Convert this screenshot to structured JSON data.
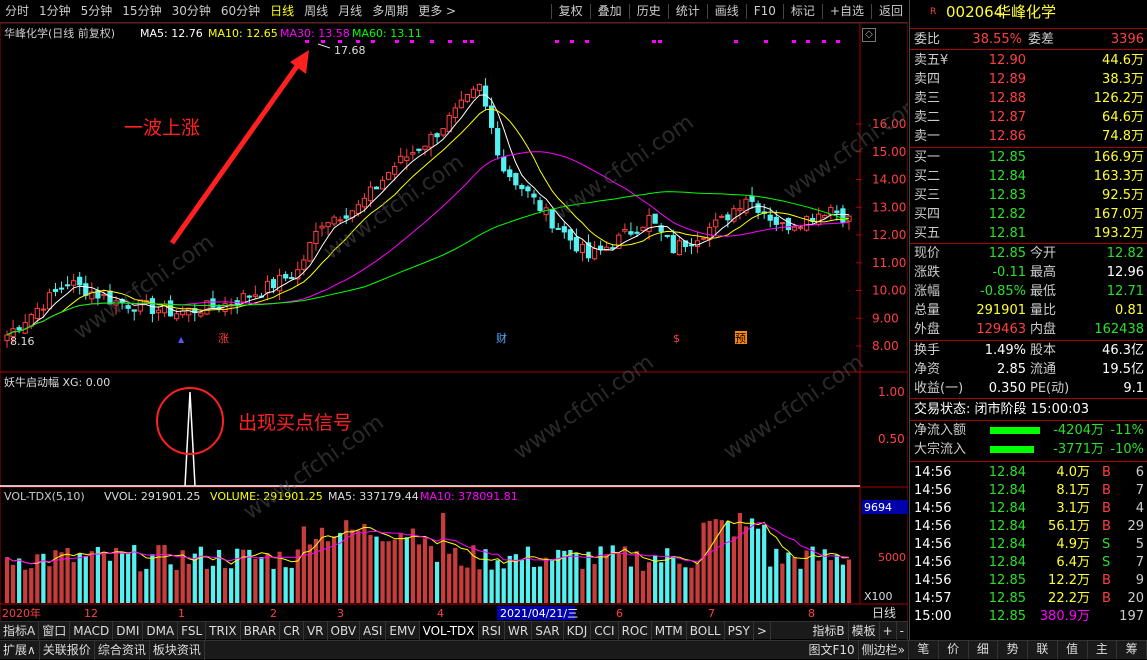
{
  "topbar": {
    "periods": [
      "分时",
      "1分钟",
      "5分钟",
      "15分钟",
      "30分钟",
      "60分钟",
      "日线",
      "周线",
      "月线",
      "多周期",
      "更多 >"
    ],
    "active_index": 6,
    "tools": [
      "复权",
      "叠加",
      "历史",
      "统计",
      "画线",
      "F10",
      "标记",
      "+自选",
      "返回"
    ]
  },
  "header": {
    "stock_title": "华峰化学(日线 前复权)",
    "ma5": "MA5: 12.76",
    "ma10": "MA10: 12.65",
    "ma30": "MA30: 13.58",
    "ma60": "MA60: 13.11",
    "close_icon": "close-icon"
  },
  "annotations": {
    "rally": "一波上涨",
    "signal": "出现买点信号",
    "high_price": "17.68",
    "low_price": "8.16"
  },
  "price_axis": [
    "16.00",
    "15.00",
    "14.00",
    "13.00",
    "12.00",
    "11.00",
    "10.00",
    "9.00",
    "8.00"
  ],
  "indicator": {
    "title": "妖牛启动幅 XG: 0.00",
    "axis": [
      "1.00",
      "0.50"
    ]
  },
  "volume": {
    "title": "VOL-TDX(5,10)",
    "vvol": "VVOL: 291901.25",
    "volume": "VOLUME: 291901.25",
    "ma5": "MA5: 337179.44",
    "ma10": "MA10: 378091.81",
    "axis_top": "9694",
    "axis_mid": "5000",
    "unit": "X100"
  },
  "markers": {
    "zhang": "涨",
    "cai": "财",
    "s": "$",
    "yu": "预"
  },
  "date_axis": {
    "labels": [
      "2020年",
      "12",
      "1",
      "2",
      "3",
      "4",
      "2021/04/21/三",
      "6",
      "7",
      "8"
    ],
    "period": "日线"
  },
  "bottombar1": [
    "指标A",
    "窗口",
    "MACD",
    "DMI",
    "DMA",
    "FSL",
    "TRIX",
    "BRAR",
    "CR",
    "VR",
    "OBV",
    "ASI",
    "EMV",
    "VOL-TDX",
    "RSI",
    "WR",
    "SAR",
    "KDJ",
    "CCI",
    "ROC",
    "MTM",
    "BOLL",
    "PSY",
    ">"
  ],
  "bottombar1_right": [
    "指标B",
    "模板",
    "+",
    "-"
  ],
  "bottombar2": [
    "扩展∧",
    "关联报价",
    "综合资讯",
    "板块资讯"
  ],
  "bottombar2_right": [
    "图文F10",
    "侧边栏»"
  ],
  "right_tabs": [
    "笔",
    "价",
    "细",
    "势",
    "联",
    "值",
    "主",
    "筹"
  ],
  "quote": {
    "code_prefix": "R",
    "code": "002064",
    "name": "华峰化学",
    "weibi_label": "委比",
    "weibi": "38.55%",
    "weicha_label": "委差",
    "weicha": "3396",
    "asks": [
      {
        "label": "卖五¥",
        "price": "12.90",
        "vol": "44.6万"
      },
      {
        "label": "卖四",
        "price": "12.89",
        "vol": "38.3万"
      },
      {
        "label": "卖三",
        "price": "12.88",
        "vol": "126.2万"
      },
      {
        "label": "卖二",
        "price": "12.87",
        "vol": "64.6万"
      },
      {
        "label": "卖一",
        "price": "12.86",
        "vol": "74.8万"
      }
    ],
    "bids": [
      {
        "label": "买一",
        "price": "12.85",
        "vol": "166.9万"
      },
      {
        "label": "买二",
        "price": "12.84",
        "vol": "163.3万"
      },
      {
        "label": "买三",
        "price": "12.83",
        "vol": "92.5万"
      },
      {
        "label": "买四",
        "price": "12.82",
        "vol": "167.0万"
      },
      {
        "label": "买五",
        "price": "12.81",
        "vol": "193.2万"
      }
    ],
    "stats": [
      {
        "l1": "现价",
        "v1": "12.85",
        "c1": "green",
        "l2": "今开",
        "v2": "12.82",
        "c2": "green"
      },
      {
        "l1": "涨跌",
        "v1": "-0.11",
        "c1": "green",
        "l2": "最高",
        "v2": "12.96",
        "c2": "wht"
      },
      {
        "l1": "涨幅",
        "v1": "-0.85%",
        "c1": "green",
        "l2": "最低",
        "v2": "12.71",
        "c2": "green"
      },
      {
        "l1": "总量",
        "v1": "291901",
        "c1": "yel",
        "l2": "量比",
        "v2": "0.81",
        "c2": "yel"
      },
      {
        "l1": "外盘",
        "v1": "129463",
        "c1": "red",
        "l2": "内盘",
        "v2": "162438",
        "c2": "green"
      }
    ],
    "stats2": [
      {
        "l1": "换手",
        "v1": "1.49%",
        "l2": "股本",
        "v2": "46.3亿"
      },
      {
        "l1": "净资",
        "v1": "2.85",
        "l2": "流通",
        "v2": "19.5亿"
      },
      {
        "l1": "收益(一)",
        "v1": "0.350",
        "l2": "PE(动)",
        "v2": "9.1"
      }
    ],
    "trade_state": "交易状态: 闭市阶段 15:00:03",
    "netflow_label": "净流入额",
    "netflow": "-4204万",
    "netflow_pct": "-11%",
    "bigflow_label": "大宗流入",
    "bigflow": "-3771万",
    "bigflow_pct": "-10%",
    "ticks": [
      {
        "t": "14:56",
        "p": "12.84",
        "v": "4.0万",
        "d": "B",
        "n": "6"
      },
      {
        "t": "14:56",
        "p": "12.84",
        "v": "8.1万",
        "d": "B",
        "n": "7"
      },
      {
        "t": "14:56",
        "p": "12.84",
        "v": "3.1万",
        "d": "B",
        "n": "4"
      },
      {
        "t": "14:56",
        "p": "12.84",
        "v": "56.1万",
        "d": "B",
        "n": "29"
      },
      {
        "t": "14:56",
        "p": "12.84",
        "v": "4.9万",
        "d": "S",
        "n": "5"
      },
      {
        "t": "14:56",
        "p": "12.84",
        "v": "6.4万",
        "d": "S",
        "n": "7"
      },
      {
        "t": "14:56",
        "p": "12.85",
        "v": "12.2万",
        "d": "B",
        "n": "9"
      },
      {
        "t": "14:57",
        "p": "12.85",
        "v": "22.2万",
        "d": "B",
        "n": "20"
      },
      {
        "t": "15:00",
        "p": "12.85",
        "v": "380.9万",
        "d": "",
        "n": "197"
      }
    ]
  },
  "watermark": "www.cfchi.com",
  "colors": {
    "up": "#ff4040",
    "down": "#55f0f0",
    "ma5": "#ffffff",
    "ma10": "#ffff00",
    "ma30": "#ff00ff",
    "ma60": "#00ff00"
  }
}
